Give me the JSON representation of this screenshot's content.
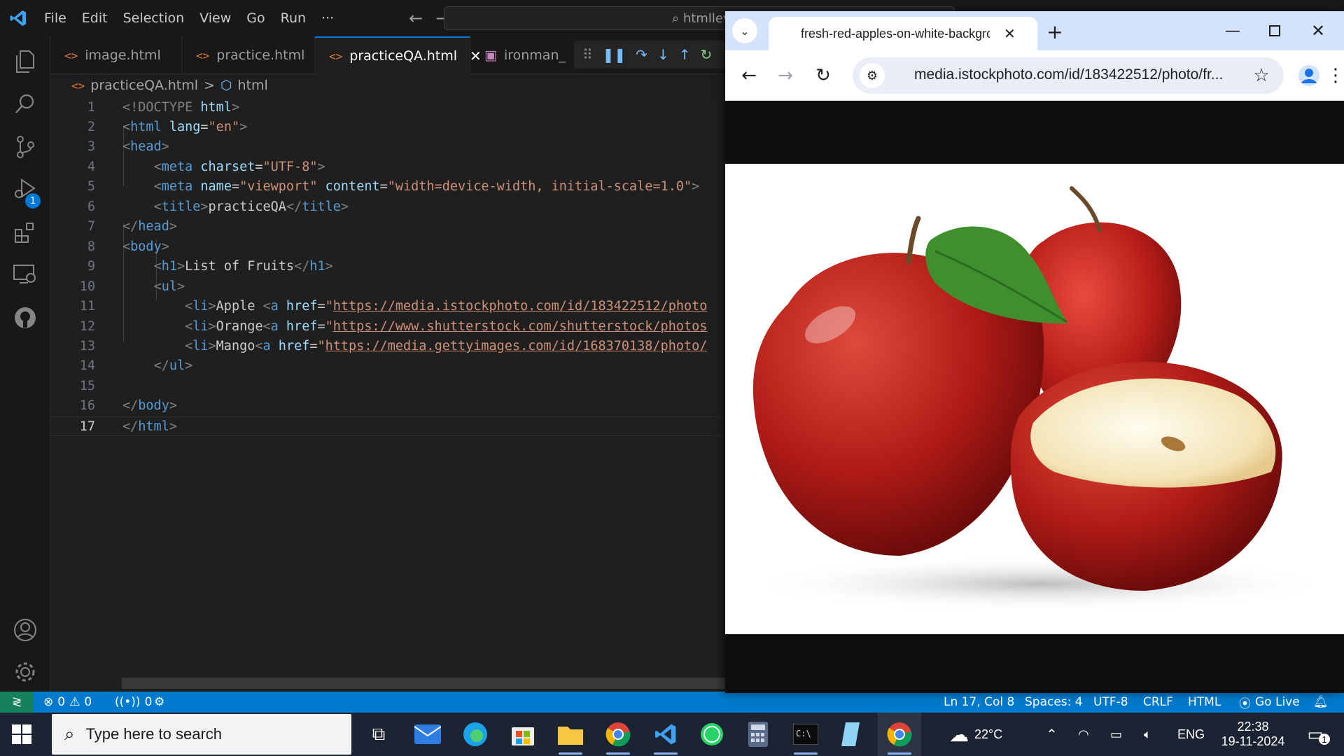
{
  "menu": [
    "File",
    "Edit",
    "Selection",
    "View",
    "Go",
    "Run",
    "···"
  ],
  "command_center": {
    "text": "htmllev"
  },
  "activity": {
    "run_debug_badge": "1"
  },
  "tabs": [
    {
      "label": "image.html",
      "icon": "html-icon"
    },
    {
      "label": "practice.html",
      "icon": "html-icon"
    },
    {
      "label": "practiceQA.html",
      "icon": "html-icon",
      "active": true
    },
    {
      "label": "ironman_",
      "icon": "image-icon"
    }
  ],
  "breadcrumb": {
    "file": "practiceQA.html",
    "sep": ">",
    "symbol": "html"
  },
  "editor": {
    "lines": [
      {
        "n": "1"
      },
      {
        "n": "2"
      },
      {
        "n": "3"
      },
      {
        "n": "4"
      },
      {
        "n": "5"
      },
      {
        "n": "6"
      },
      {
        "n": "7"
      },
      {
        "n": "8"
      },
      {
        "n": "9"
      },
      {
        "n": "10"
      },
      {
        "n": "11"
      },
      {
        "n": "12"
      },
      {
        "n": "13"
      },
      {
        "n": "14"
      },
      {
        "n": "15"
      },
      {
        "n": "16"
      },
      {
        "n": "17"
      }
    ],
    "tokens": {
      "doctype": "<!DOCTYPE",
      "html": "html",
      "lang_attr": "lang",
      "lang_val": "\"en\"",
      "head": "head",
      "meta": "meta",
      "charset_attr": "charset",
      "charset_val": "\"UTF-8\"",
      "name_attr": "name",
      "name_val": "\"viewport\"",
      "content_attr": "content",
      "content_val": "\"width=device-width, initial-scale=1.0\"",
      "title": "title",
      "title_text": "practiceQA",
      "body": "body",
      "h1": "h1",
      "h1_text": "List of Fruits",
      "ul": "ul",
      "li": "li",
      "a": "a",
      "href_attr": "href",
      "apple": "Apple ",
      "orange": "Orange",
      "mango": "Mango",
      "apple_url": "https://media.istockphoto.com/id/183422512/photo",
      "orange_url": "https://www.shutterstock.com/shutterstock/photos",
      "mango_url": "https://media.gettyimages.com/id/168370138/photo/"
    }
  },
  "statusbar": {
    "errors": "0",
    "warnings": "0",
    "ports": "0",
    "cursor": "Ln 17, Col 8",
    "spaces": "Spaces: 4",
    "encoding": "UTF-8",
    "eol": "CRLF",
    "language": "HTML",
    "golive": "Go Live"
  },
  "chrome": {
    "tab_title": "fresh-red-apples-on-white-background",
    "url": "media.istockphoto.com/id/183422512/photo/fr..."
  },
  "taskbar": {
    "search_placeholder": "Type here to search",
    "weather": "22°C",
    "language": "ENG",
    "time": "22:38",
    "date": "19-11-2024",
    "notification_count": "1"
  },
  "colors": {
    "accent": "#0078d4",
    "statusbar": "#007acc",
    "chrome_tabstrip": "#d3e3fd"
  }
}
